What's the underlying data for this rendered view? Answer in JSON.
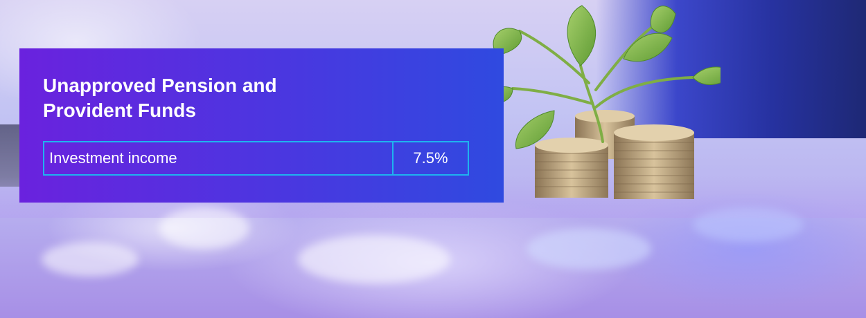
{
  "panel": {
    "title": "Unapproved Pension and Provident Funds",
    "rows": [
      {
        "label": "Investment income",
        "value": "7.5%"
      }
    ]
  },
  "colors": {
    "panel_gradient_start": "#6a22de",
    "panel_gradient_end": "#2f4ae0",
    "table_border": "#1fb3ef",
    "text": "#ffffff"
  },
  "background": {
    "icon": "coins-with-plant-photo"
  }
}
